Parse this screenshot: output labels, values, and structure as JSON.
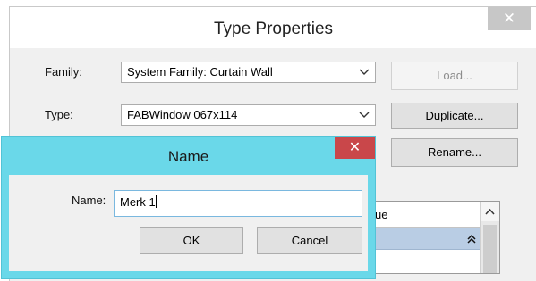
{
  "type_properties": {
    "title": "Type Properties",
    "close_glyph": "✕",
    "family_label": "Family:",
    "family_value": "System Family: Curtain Wall",
    "type_label": "Type:",
    "type_value": "FABWindow 067x114",
    "load_button": "Load...",
    "duplicate_button": "Duplicate...",
    "rename_button": "Rename...",
    "grid_header_partial": "ue"
  },
  "name_dialog": {
    "title": "Name",
    "close_glyph": "✕",
    "name_label": "Name:",
    "name_value": "Merk 1",
    "ok_button": "OK",
    "cancel_button": "Cancel"
  },
  "colors": {
    "accent_frame": "#6ad8e9",
    "close_red": "#c9474a",
    "band_blue": "#b9cde4"
  },
  "icons": {
    "combo_arrow": "chevron-down-icon",
    "scroll_up": "chevron-up-icon",
    "band_toggle": "double-chevron-up-icon"
  }
}
